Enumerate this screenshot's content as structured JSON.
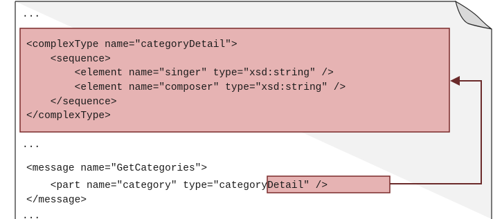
{
  "document": {
    "ellipsis_top": "...",
    "schema_lines": [
      "<complexType name=\"categoryDetail\">",
      "    <sequence>",
      "        <element name=\"singer\" type=\"xsd:string\" />",
      "        <element name=\"composer\" type=\"xsd:string\" />",
      "    </sequence>",
      "</complexType>"
    ],
    "ellipsis_middle": "...",
    "message_open": "<message name=\"GetCategories\">",
    "part_prefix": "    <part name=\"category\" type=",
    "part_type_value": "\"categoryDetail\"",
    "part_suffix": " />",
    "message_close": "</message>",
    "ellipsis_bottom": "..."
  },
  "colors": {
    "page_fill": "#f2f2f2",
    "page_border": "#262626",
    "highlight_fill": "#e6b3b3",
    "highlight_border": "#7a2a2a",
    "arrow_color": "#6b2a2a"
  }
}
